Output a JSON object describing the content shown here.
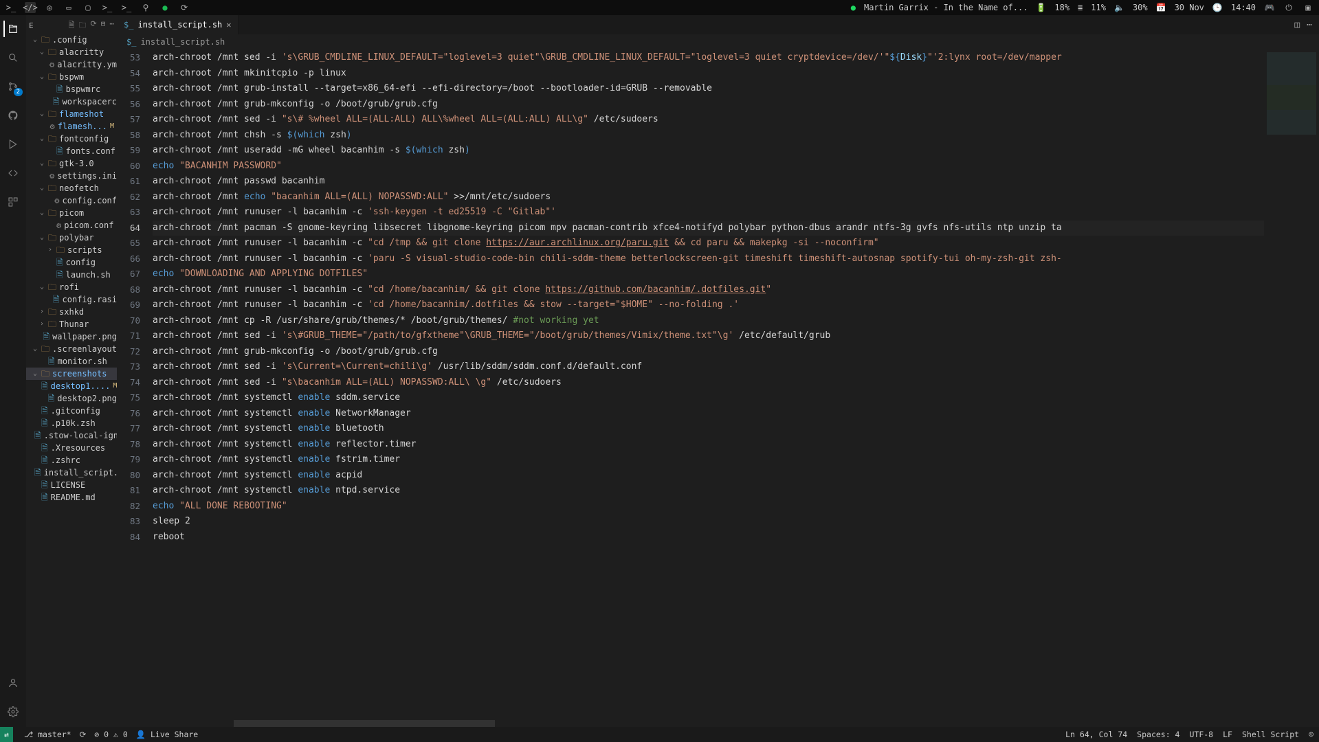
{
  "topbar": {
    "spotify": "Martin Garrix - In the Name of...",
    "bat": "18%",
    "mem": "11%",
    "vol": "30%",
    "date": "30 Nov",
    "time": "14:40"
  },
  "sidebar": {
    "header": "E",
    "tree": [
      {
        "d": 0,
        "open": true,
        "type": "folder",
        "name": ".config"
      },
      {
        "d": 1,
        "open": true,
        "type": "folder",
        "name": "alacritty"
      },
      {
        "d": 2,
        "type": "file",
        "name": "alacritty.yml",
        "icon": "gear"
      },
      {
        "d": 1,
        "open": true,
        "type": "folder",
        "name": "bspwm"
      },
      {
        "d": 2,
        "type": "file",
        "name": "bspwmrc"
      },
      {
        "d": 2,
        "type": "file",
        "name": "workspacerc"
      },
      {
        "d": 1,
        "open": true,
        "type": "folder",
        "name": "flameshot",
        "hl": true
      },
      {
        "d": 2,
        "type": "file",
        "name": "flamesh...",
        "icon": "gear",
        "mod": "M",
        "hl": true
      },
      {
        "d": 1,
        "open": true,
        "type": "folder",
        "name": "fontconfig"
      },
      {
        "d": 2,
        "type": "file",
        "name": "fonts.conf"
      },
      {
        "d": 1,
        "open": true,
        "type": "folder",
        "name": "gtk-3.0"
      },
      {
        "d": 2,
        "type": "file",
        "name": "settings.ini",
        "icon": "gear"
      },
      {
        "d": 1,
        "open": true,
        "type": "folder",
        "name": "neofetch"
      },
      {
        "d": 2,
        "type": "file",
        "name": "config.conf",
        "icon": "gear"
      },
      {
        "d": 1,
        "open": true,
        "type": "folder",
        "name": "picom"
      },
      {
        "d": 2,
        "type": "file",
        "name": "picom.conf",
        "icon": "gear"
      },
      {
        "d": 1,
        "open": true,
        "type": "folder",
        "name": "polybar"
      },
      {
        "d": 2,
        "closed": true,
        "type": "folder",
        "name": "scripts"
      },
      {
        "d": 2,
        "type": "file",
        "name": "config"
      },
      {
        "d": 2,
        "type": "file",
        "name": "launch.sh"
      },
      {
        "d": 1,
        "open": true,
        "type": "folder",
        "name": "rofi"
      },
      {
        "d": 2,
        "type": "file",
        "name": "config.rasi"
      },
      {
        "d": 1,
        "closed": true,
        "type": "folder",
        "name": "sxhkd"
      },
      {
        "d": 1,
        "type": "folder",
        "name": "Thunar"
      },
      {
        "d": 1,
        "type": "file",
        "name": "wallpaper.png"
      },
      {
        "d": 0,
        "open": true,
        "type": "folder",
        "name": ".screenlayout"
      },
      {
        "d": 1,
        "type": "file",
        "name": "monitor.sh"
      },
      {
        "d": 0,
        "open": true,
        "type": "folder",
        "name": "screenshots",
        "hl": true,
        "selected": true,
        "fhl": true
      },
      {
        "d": 1,
        "type": "file",
        "name": "desktop1....",
        "mod": "M",
        "hl": true
      },
      {
        "d": 1,
        "type": "file",
        "name": "desktop2.png"
      },
      {
        "d": 0,
        "type": "file",
        "name": ".gitconfig"
      },
      {
        "d": 0,
        "type": "file",
        "name": ".p10k.zsh"
      },
      {
        "d": 0,
        "type": "file",
        "name": ".stow-local-ignore"
      },
      {
        "d": 0,
        "type": "file",
        "name": ".Xresources"
      },
      {
        "d": 0,
        "type": "file",
        "name": ".zshrc"
      },
      {
        "d": 0,
        "type": "file",
        "name": "install_script.sh"
      },
      {
        "d": 0,
        "type": "file",
        "name": "LICENSE"
      },
      {
        "d": 0,
        "type": "file",
        "name": "README.md"
      }
    ]
  },
  "editor": {
    "tab_label": "install_script.sh",
    "breadcrumb": "install_script.sh",
    "first_line_no": 53,
    "current_line_no": 64,
    "lines": [
      [
        [
          "",
          "arch-chroot /mnt sed -i "
        ],
        [
          "str",
          "'s\\GRUB_CMDLINE_LINUX_DEFAULT=\"loglevel=3 quiet\"\\GRUB_CMDLINE_LINUX_DEFAULT=\"loglevel=3 quiet cryptdevice=/dev/'"
        ],
        [
          "str",
          "\""
        ],
        [
          "dol",
          "${"
        ],
        [
          "var",
          "Disk"
        ],
        [
          "dol",
          "}"
        ],
        [
          "str",
          "\""
        ],
        [
          "str",
          "'2:lynx root=/dev/mapper"
        ]
      ],
      [
        [
          "",
          "arch-chroot /mnt mkinitcpio -p linux"
        ]
      ],
      [
        [
          "",
          "arch-chroot /mnt grub-install --target=x86_64-efi --efi-directory=/boot --bootloader-id=GRUB --removable"
        ]
      ],
      [
        [
          "",
          "arch-chroot /mnt grub-mkconfig -o /boot/grub/grub.cfg"
        ]
      ],
      [
        [
          "",
          "arch-chroot /mnt sed -i "
        ],
        [
          "str",
          "\"s\\# %wheel ALL=(ALL:ALL) ALL\\%wheel ALL=(ALL:ALL) ALL\\g\""
        ],
        [
          "",
          " /etc/sudoers"
        ]
      ],
      [
        [
          "",
          "arch-chroot /mnt chsh -s "
        ],
        [
          "dol",
          "$("
        ],
        [
          "key",
          "which"
        ],
        [
          "",
          " zsh"
        ],
        [
          "dol",
          ")"
        ]
      ],
      [
        [
          "",
          "arch-chroot /mnt useradd -mG wheel bacanhim -s "
        ],
        [
          "dol",
          "$("
        ],
        [
          "key",
          "which"
        ],
        [
          "",
          " zsh"
        ],
        [
          "dol",
          ")"
        ]
      ],
      [
        [
          "key",
          "echo"
        ],
        [
          "",
          " "
        ],
        [
          "str",
          "\"BACANHIM PASSWORD\""
        ]
      ],
      [
        [
          "",
          "arch-chroot /mnt passwd bacanhim"
        ]
      ],
      [
        [
          "",
          "arch-chroot /mnt "
        ],
        [
          "key",
          "echo"
        ],
        [
          "",
          " "
        ],
        [
          "str",
          "\"bacanhim ALL=(ALL) NOPASSWD:ALL\""
        ],
        [
          "",
          " >>/mnt/etc/sudoers"
        ]
      ],
      [
        [
          "",
          "arch-chroot /mnt runuser -l bacanhim -c "
        ],
        [
          "str",
          "'ssh-keygen -t ed25519 -C \"Gitlab\"'"
        ]
      ],
      [
        [
          "",
          "arch-chroot /mnt pacman -S gnome-keyring libsecret libgnome-keyring picom mpv pacman-contrib xfce4-notifyd polybar python-dbus arandr ntfs-3g gvfs nfs-utils ntp unzip ta"
        ]
      ],
      [
        [
          "",
          "arch-chroot /mnt runuser -l bacanhim -c "
        ],
        [
          "str",
          "\"cd /tmp && git clone "
        ],
        [
          "link",
          "https://aur.archlinux.org/paru.git"
        ],
        [
          "str",
          " && cd paru && makepkg -si --noconfirm\""
        ]
      ],
      [
        [
          "",
          "arch-chroot /mnt runuser -l bacanhim -c "
        ],
        [
          "str",
          "'paru -S visual-studio-code-bin chili-sddm-theme betterlockscreen-git timeshift timeshift-autosnap spotify-tui oh-my-zsh-git zsh-"
        ]
      ],
      [
        [
          "key",
          "echo"
        ],
        [
          "",
          " "
        ],
        [
          "str",
          "\"DOWNLOADING AND APPLYING DOTFILES\""
        ]
      ],
      [
        [
          "",
          "arch-chroot /mnt runuser -l bacanhim -c "
        ],
        [
          "str",
          "\"cd /home/bacanhim/ && git clone "
        ],
        [
          "link",
          "https://github.com/bacanhim/.dotfiles.git"
        ],
        [
          "str",
          "\""
        ]
      ],
      [
        [
          "",
          "arch-chroot /mnt runuser -l bacanhim -c "
        ],
        [
          "str",
          "'cd /home/bacanhim/.dotfiles && stow --target=\"$HOME\" --no-folding .'"
        ]
      ],
      [
        [
          "",
          "arch-chroot /mnt cp -R /usr/share/grub/themes/* /boot/grub/themes/ "
        ],
        [
          "com",
          "#not working yet"
        ]
      ],
      [
        [
          "",
          "arch-chroot /mnt sed -i "
        ],
        [
          "str",
          "'s\\#GRUB_THEME=\"/path/to/gfxtheme\"\\GRUB_THEME=\"/boot/grub/themes/Vimix/theme.txt\"\\g'"
        ],
        [
          "",
          " /etc/default/grub"
        ]
      ],
      [
        [
          "",
          "arch-chroot /mnt grub-mkconfig -o /boot/grub/grub.cfg"
        ]
      ],
      [
        [
          "",
          "arch-chroot /mnt sed -i "
        ],
        [
          "str",
          "'s\\Current=\\Current=chili\\g'"
        ],
        [
          "",
          " /usr/lib/sddm/sddm.conf.d/default.conf"
        ]
      ],
      [
        [
          "",
          "arch-chroot /mnt sed -i "
        ],
        [
          "str",
          "\"s\\bacanhim ALL=(ALL) NOPASSWD:ALL\\ \\g\""
        ],
        [
          "",
          " /etc/sudoers"
        ]
      ],
      [
        [
          "",
          "arch-chroot /mnt systemctl "
        ],
        [
          "key",
          "enable"
        ],
        [
          "",
          " sddm.service"
        ]
      ],
      [
        [
          "",
          "arch-chroot /mnt systemctl "
        ],
        [
          "key",
          "enable"
        ],
        [
          "",
          " NetworkManager"
        ]
      ],
      [
        [
          "",
          "arch-chroot /mnt systemctl "
        ],
        [
          "key",
          "enable"
        ],
        [
          "",
          " bluetooth"
        ]
      ],
      [
        [
          "",
          "arch-chroot /mnt systemctl "
        ],
        [
          "key",
          "enable"
        ],
        [
          "",
          " reflector.timer"
        ]
      ],
      [
        [
          "",
          "arch-chroot /mnt systemctl "
        ],
        [
          "key",
          "enable"
        ],
        [
          "",
          " fstrim.timer"
        ]
      ],
      [
        [
          "",
          "arch-chroot /mnt systemctl "
        ],
        [
          "key",
          "enable"
        ],
        [
          "",
          " acpid"
        ]
      ],
      [
        [
          "",
          "arch-chroot /mnt systemctl "
        ],
        [
          "key",
          "enable"
        ],
        [
          "",
          " ntpd.service"
        ]
      ],
      [
        [
          "key",
          "echo"
        ],
        [
          "",
          " "
        ],
        [
          "str",
          "\"ALL DONE REBOOTING\""
        ]
      ],
      [
        [
          "",
          "sleep 2"
        ]
      ],
      [
        [
          "",
          "reboot"
        ]
      ]
    ]
  },
  "status": {
    "branch": "master*",
    "sync": "",
    "errors": "0",
    "warns": "0",
    "live": "Live Share",
    "pos": "Ln 64, Col 74",
    "spaces": "Spaces: 4",
    "enc": "UTF-8",
    "eol": "LF",
    "lang": "Shell Script"
  },
  "source_control_badge": "2"
}
